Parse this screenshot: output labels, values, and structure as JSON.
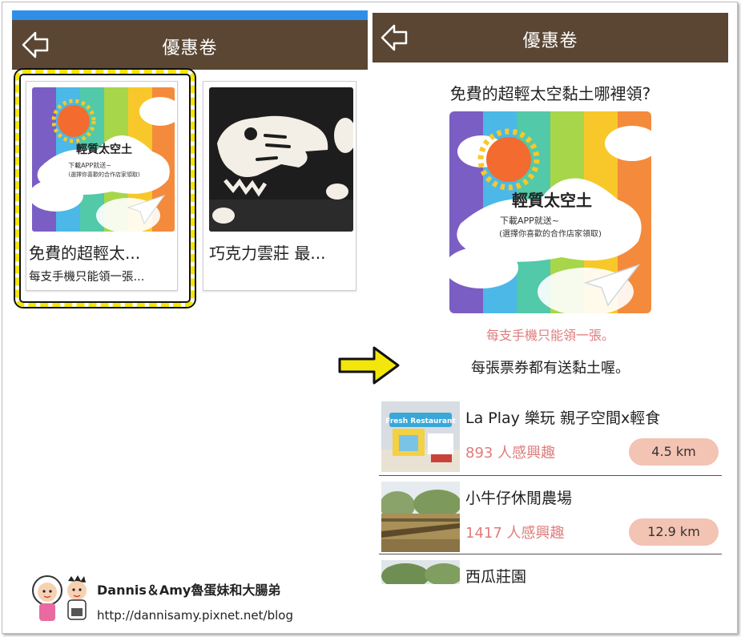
{
  "left_screen": {
    "nav_title": "優惠卷",
    "cards": [
      {
        "title": "免費的超輕太...",
        "subtitle": "每支手機只能領一張..."
      },
      {
        "title": "巧克力雲莊 最...",
        "subtitle": ""
      }
    ],
    "banner": {
      "headline": "輕質太空土",
      "line1": "下載APP就送~",
      "line2": "(選擇你喜歡的合作店家領取)"
    }
  },
  "right_screen": {
    "nav_title": "優惠卷",
    "heading": "免費的超輕太空黏土哪裡領?",
    "banner": {
      "headline": "輕質太空土",
      "line1": "下載APP就送~",
      "line2": "(選擇你喜歡的合作店家領取)"
    },
    "note_limit": "每支手機只能領一張。",
    "note_gift": "每張票券都有送黏土喔。",
    "places": [
      {
        "name": "La Play 樂玩 親子空間x輕食",
        "interest": "893 人感興趣",
        "distance": "4.5 km",
        "sign": "Fresh Restaurant"
      },
      {
        "name": "小牛仔休閒農場",
        "interest": "1417 人感興趣",
        "distance": "12.9 km",
        "sign": ""
      },
      {
        "name": "西瓜莊園",
        "interest": "",
        "distance": "",
        "sign": ""
      }
    ]
  },
  "watermark": {
    "name": "Dannis＆Amy魯蛋妹和大腸弟",
    "url": "http://dannisamy.pixnet.net/blog"
  },
  "colors": {
    "navbar": "#5a4633",
    "status_bar": "#2f8fe8",
    "accent_pink": "#e07c7c",
    "distance_pill": "#f3c3b3",
    "highlight": "#f3e60a"
  },
  "icons": [
    "back-arrow-icon",
    "right-arrow-icon",
    "sun-icon",
    "paper-plane-icon"
  ]
}
